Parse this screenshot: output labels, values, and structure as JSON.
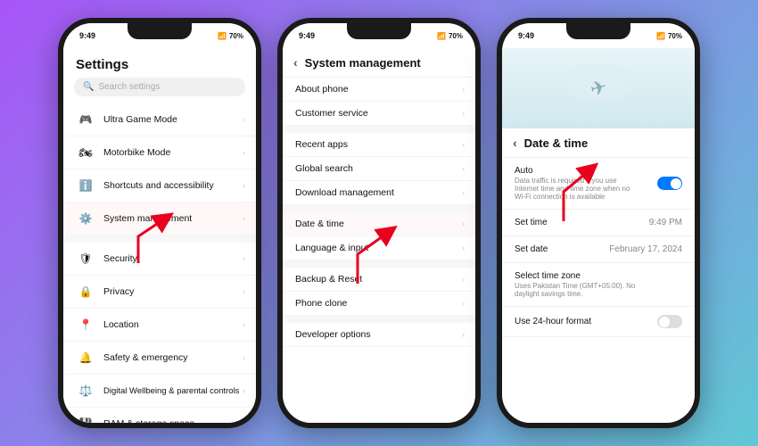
{
  "statusBar": {
    "time": "9:49",
    "battery": "70%",
    "signal": "●●●"
  },
  "phone1": {
    "title": "Settings",
    "search": {
      "placeholder": "Search settings"
    },
    "items": [
      {
        "icon": "🎮",
        "label": "Ultra Game Mode",
        "color": "#f0f0f0"
      },
      {
        "icon": "🏍",
        "label": "Motorbike Mode",
        "color": "#f0f0f0"
      },
      {
        "icon": "ℹ️",
        "label": "Shortcuts and accessibility",
        "color": "#f0f0f0"
      },
      {
        "icon": "⚙️",
        "label": "System management",
        "color": "#f0f0f0",
        "highlighted": true
      },
      {
        "divider": true
      },
      {
        "icon": "🛡",
        "label": "Security",
        "color": "#f0f0f0"
      },
      {
        "icon": "🔒",
        "label": "Privacy",
        "color": "#f0f0f0"
      },
      {
        "icon": "📍",
        "label": "Location",
        "color": "#f0f0f0"
      },
      {
        "icon": "🔔",
        "label": "Safety & emergency",
        "color": "#f0f0f0"
      },
      {
        "icon": "⚖️",
        "label": "Digital Wellbeing & parental controls",
        "color": "#f0f0f0"
      },
      {
        "icon": "💾",
        "label": "RAM & storage space",
        "color": "#f0f0f0"
      }
    ]
  },
  "phone2": {
    "backLabel": "",
    "title": "System management",
    "items": [
      {
        "label": "About phone"
      },
      {
        "label": "Customer service"
      },
      {
        "divider": true
      },
      {
        "label": "Recent apps"
      },
      {
        "label": "Global search"
      },
      {
        "label": "Download management"
      },
      {
        "divider": true
      },
      {
        "label": "Date & time",
        "highlighted": true
      },
      {
        "label": "Language & input"
      },
      {
        "divider": true
      },
      {
        "label": "Backup & Reset"
      },
      {
        "label": "Phone clone"
      },
      {
        "divider": true
      },
      {
        "label": "Developer options"
      }
    ]
  },
  "phone3": {
    "title": "Date & time",
    "rows": [
      {
        "label": "Auto",
        "sub": "Data traffic is required if you use Internet time and time zone when no Wi-Fi connection is available",
        "type": "toggle",
        "value": true
      },
      {
        "label": "Set time",
        "value": "9:49 PM",
        "type": "value"
      },
      {
        "label": "Set date",
        "value": "February 17, 2024",
        "type": "value"
      },
      {
        "label": "Select time zone",
        "sub": "Uses Pakistan Time (GMT+05:00). No daylight savings time.",
        "type": "none"
      },
      {
        "label": "Use 24-hour format",
        "type": "toggle-off",
        "value": false
      }
    ]
  }
}
